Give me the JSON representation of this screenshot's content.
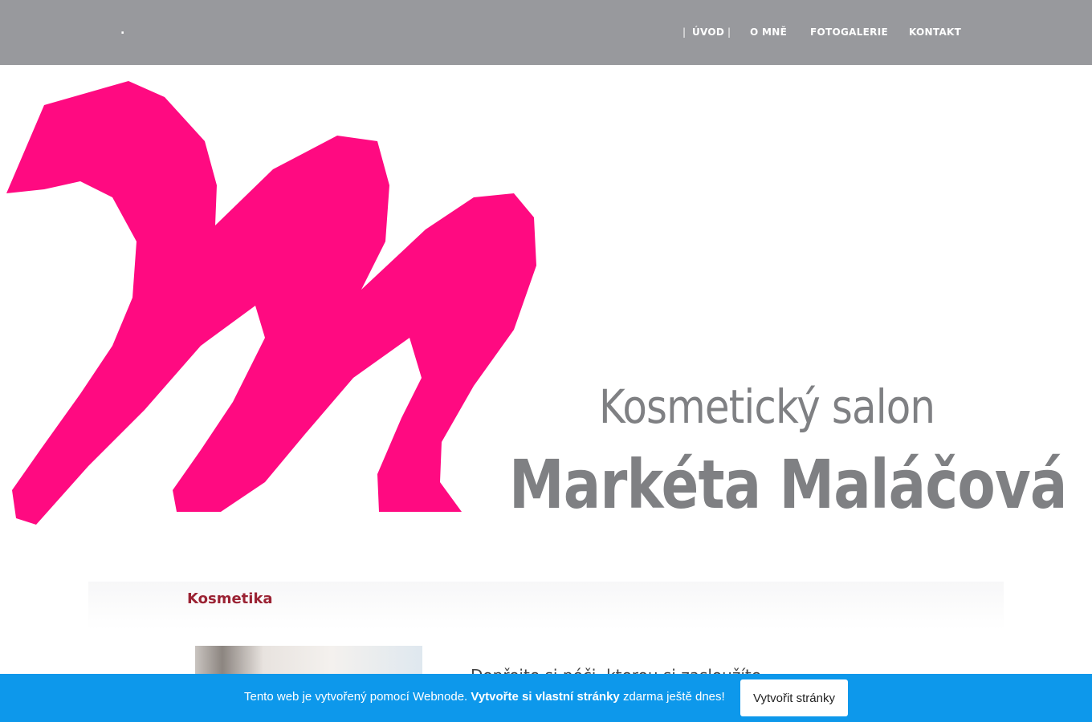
{
  "header": {
    "logo_text": ".",
    "nav": [
      {
        "label": "ÚVOD",
        "active": true
      },
      {
        "label": "O MNĚ",
        "active": false
      },
      {
        "label": "FOTOGALERIE",
        "active": false
      },
      {
        "label": "KONTAKT",
        "active": false
      }
    ],
    "separator": "|"
  },
  "hero": {
    "line1": "Kosmetický salon",
    "line2": "Markéta Maláčová",
    "brand_color": "#ff0a81",
    "text_color": "#7f8083"
  },
  "section": {
    "title": "Kosmetika",
    "text": "Dopřejte si péči, kterou si zasloužíte"
  },
  "banner": {
    "text_before": "Tento web je vytvořený pomocí Webnode.",
    "text_bold": "Vytvořte si vlastní stránky",
    "text_after": "zdarma ještě dnes!",
    "button_label": "Vytvořit stránky",
    "background": "#0d98eb"
  }
}
